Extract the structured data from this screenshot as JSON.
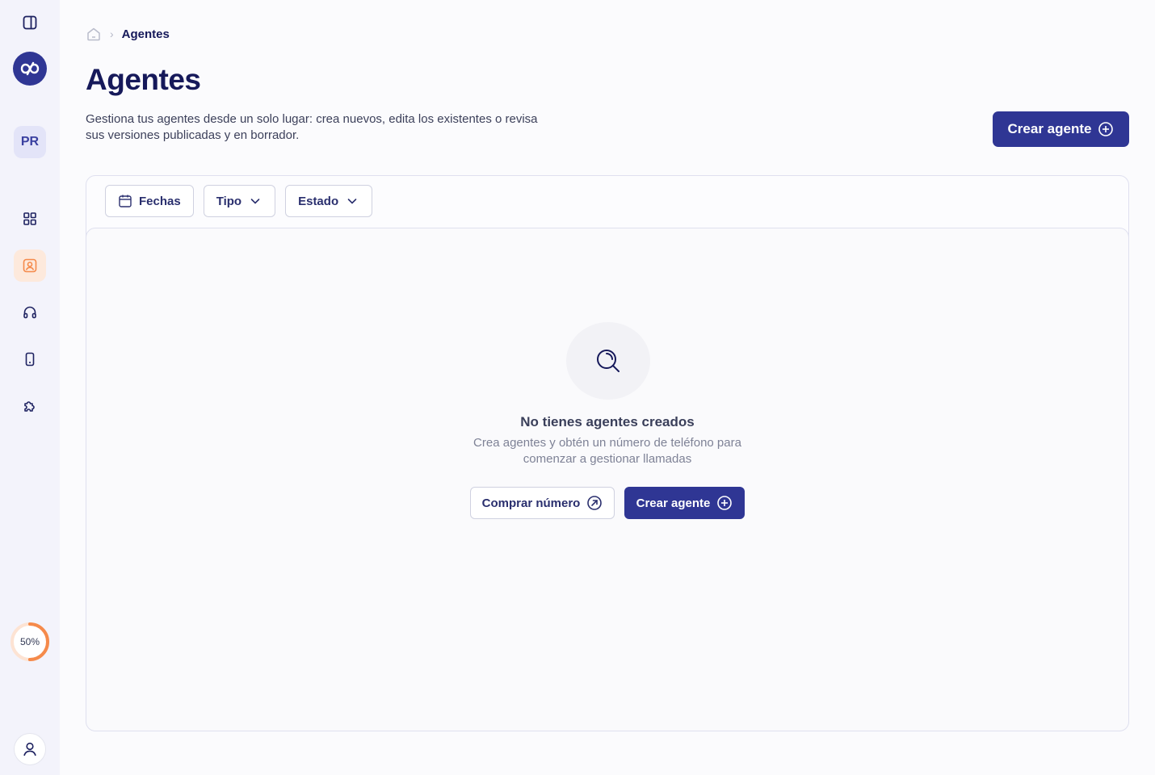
{
  "sidebar": {
    "workspace_initials": "PR",
    "usage_progress_label": "50%",
    "usage_progress_value": 0.5,
    "items": [
      {
        "name": "dashboard",
        "icon": "grid-icon"
      },
      {
        "name": "agents",
        "icon": "contact-card-icon",
        "active": true
      },
      {
        "name": "support",
        "icon": "headphones-icon"
      },
      {
        "name": "phone",
        "icon": "mobile-phone-icon"
      },
      {
        "name": "integrations",
        "icon": "puzzle-icon"
      }
    ]
  },
  "breadcrumb": {
    "home_icon": "home-icon",
    "current": "Agentes"
  },
  "header": {
    "title": "Agentes",
    "description": "Gestiona tus agentes desde un solo lugar: crea nuevos, edita los existentes o revisa sus versiones publicadas y en borrador.",
    "create_button": "Crear agente"
  },
  "filters": {
    "dates": "Fechas",
    "type": "Tipo",
    "status": "Estado"
  },
  "empty_state": {
    "title": "No tienes agentes creados",
    "description": "Crea agentes y obtén un número de teléfono para comenzar a gestionar llamadas",
    "buy_number_button": "Comprar número",
    "create_button": "Crear agente"
  },
  "colors": {
    "primary": "#2f3694",
    "accent_orange": "#f58a4b",
    "sidebar_bg": "#f3f3fb",
    "text_dark": "#16195a"
  }
}
